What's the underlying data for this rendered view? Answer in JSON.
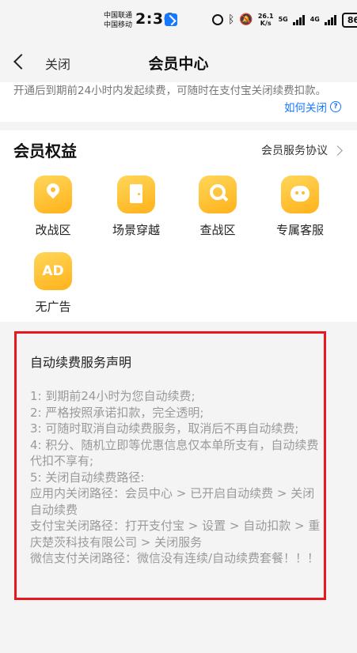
{
  "status_bar": {
    "carrier_1": "中国联通",
    "carrier_2": "中国移动",
    "time": "2:36",
    "net_speed_value": "26.1",
    "net_speed_unit": "K/s",
    "net_1": "5G",
    "net_2": "4G",
    "battery": "86"
  },
  "nav": {
    "close_label": "关闭",
    "title": "会员中心"
  },
  "notice": {
    "text": "开通后到期前24小时内发起续费，可随时在支付宝关闭续费扣款。",
    "how_to_close": "如何关闭",
    "help_glyph": "?"
  },
  "benefits": {
    "title": "会员权益",
    "agreement_link": "会员服务协议",
    "items": [
      {
        "label": "改战区",
        "icon": "location-pin-icon"
      },
      {
        "label": "场景穿越",
        "icon": "door-icon"
      },
      {
        "label": "查战区",
        "icon": "search-q-icon"
      },
      {
        "label": "专属客服",
        "icon": "customer-service-icon"
      },
      {
        "label": "无广告",
        "icon": "ad-icon",
        "icon_text": "AD"
      }
    ]
  },
  "statement": {
    "title": "自动续费服务声明",
    "lines": [
      "1:  到期前24小时为您自动续费;",
      "2:  严格按照承诺扣款，完全透明;",
      "3:  可随时取消自动续费服务，取消后不再自动续费;",
      "4:  积分、随机立即等优惠信息仅本单所支有，自动续费代扣不享有;",
      "5:  关闭自动续费路径:",
      "应用内关闭路径：会员中心 > 已开启自动续费 > 关闭自动续费",
      "支付宝关闭路径：打开支付宝 > 设置 > 自动扣款 > 重庆楚茨科技有限公司 > 关闭服务",
      "微信支付关闭路径：微信没有连续/自动续费套餐！！！"
    ]
  },
  "colors": {
    "accent_blue": "#1677ff",
    "icon_yellow": "#ffbd2e",
    "highlight_red": "#e8171d"
  }
}
